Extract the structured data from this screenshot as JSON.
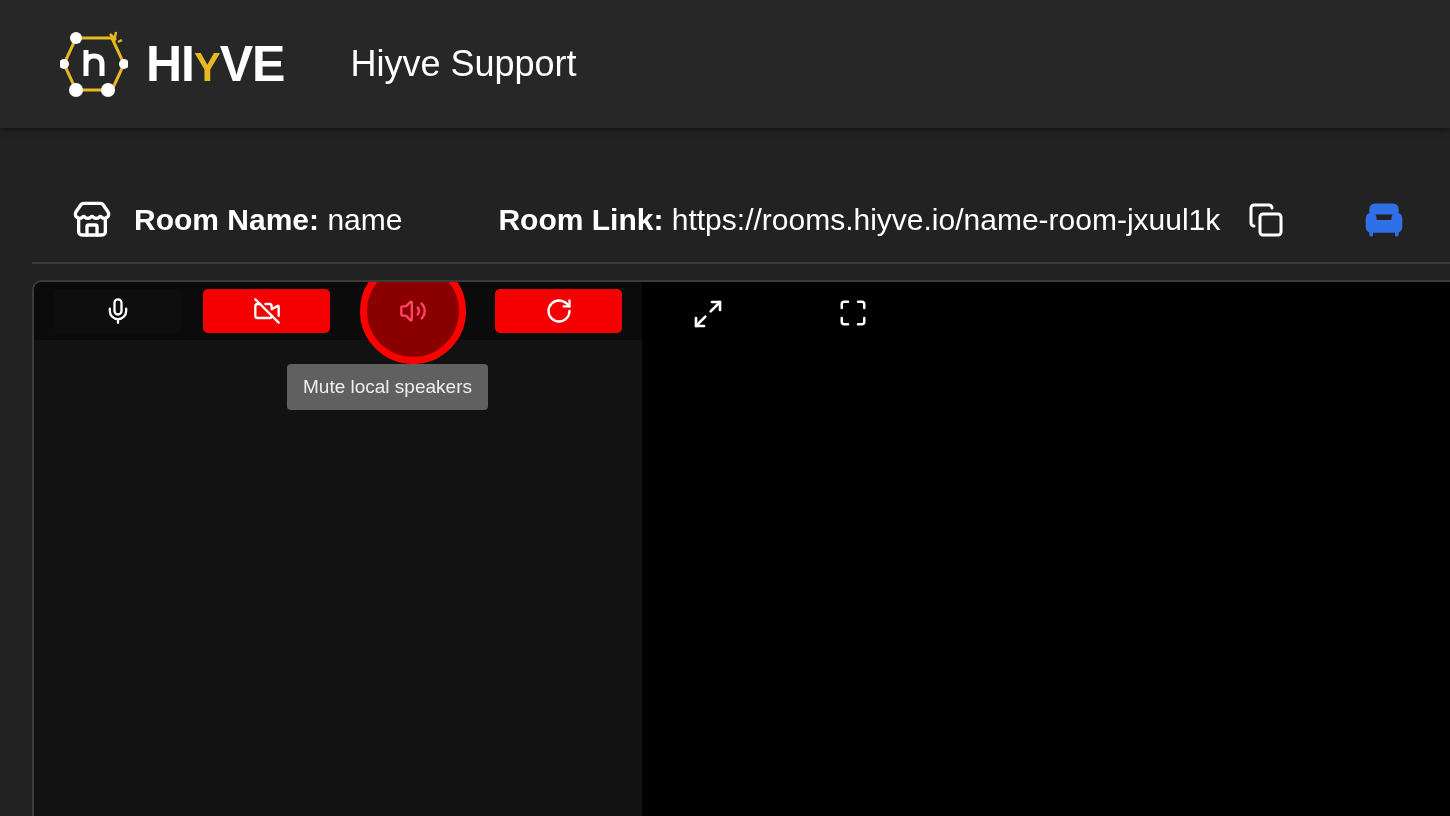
{
  "header": {
    "logo_parts": [
      {
        "text": "HI",
        "accent": false
      },
      {
        "text": "Y",
        "accent": true
      },
      {
        "text": "VE",
        "accent": false
      }
    ],
    "title": "Hiyve Support"
  },
  "room_info": {
    "name_label": "Room Name:",
    "name_value": "name",
    "link_label": "Room Link:",
    "link_value": "https://rooms.hiyve.io/name-room-jxuul1k"
  },
  "controls": [
    {
      "kind": "mic",
      "active": false,
      "circled": false
    },
    {
      "kind": "camera-off",
      "active": true,
      "circled": false
    },
    {
      "kind": "speaker",
      "active": false,
      "circled": true
    },
    {
      "kind": "refresh",
      "active": true,
      "circled": false
    }
  ],
  "tooltip": "Mute local speakers"
}
